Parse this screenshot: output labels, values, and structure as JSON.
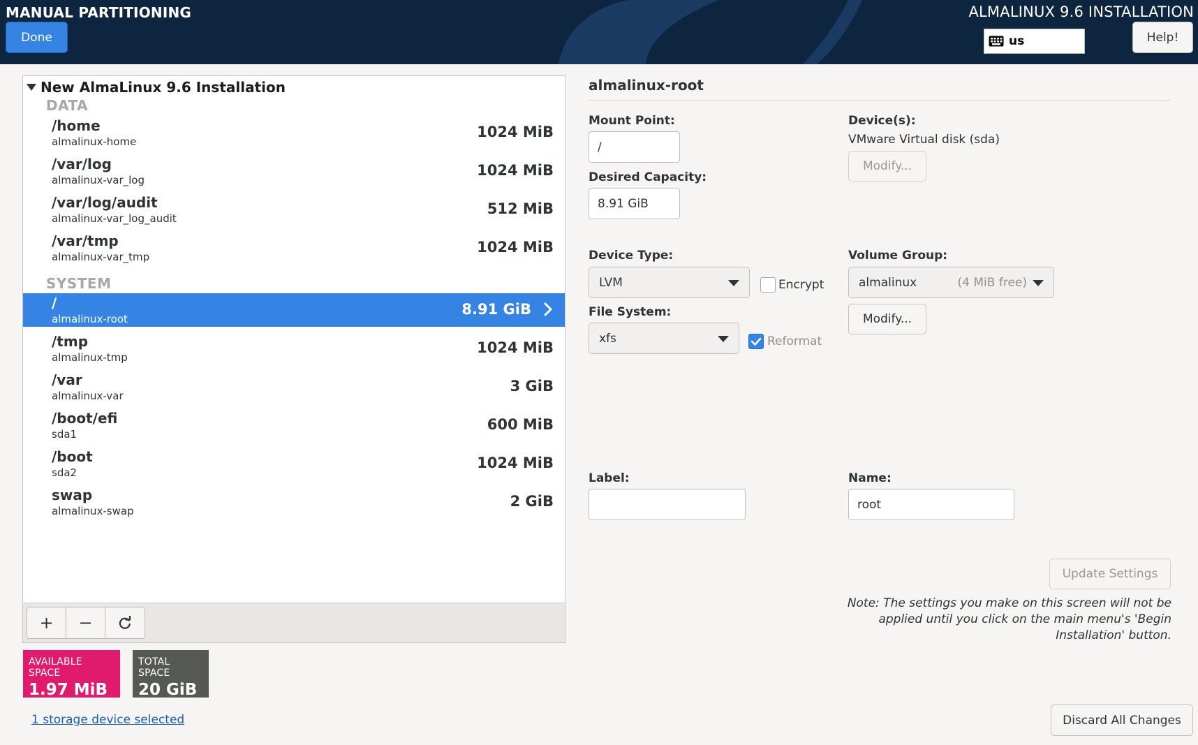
{
  "header": {
    "spoke_title": "MANUAL PARTITIONING",
    "done_label": "Done",
    "product_title": "ALMALINUX 9.6 INSTALLATION",
    "keyboard_layout": "us",
    "help_label": "Help!"
  },
  "tree": {
    "root_label": "New AlmaLinux 9.6 Installation",
    "groups": [
      {
        "name": "DATA",
        "rows": [
          {
            "mount": "/home",
            "device": "almalinux-home",
            "size": "1024 MiB"
          },
          {
            "mount": "/var/log",
            "device": "almalinux-var_log",
            "size": "1024 MiB"
          },
          {
            "mount": "/var/log/audit",
            "device": "almalinux-var_log_audit",
            "size": "512 MiB"
          },
          {
            "mount": "/var/tmp",
            "device": "almalinux-var_tmp",
            "size": "1024 MiB"
          }
        ]
      },
      {
        "name": "SYSTEM",
        "rows": [
          {
            "mount": "/",
            "device": "almalinux-root",
            "size": "8.91 GiB",
            "selected": true
          },
          {
            "mount": "/tmp",
            "device": "almalinux-tmp",
            "size": "1024 MiB"
          },
          {
            "mount": "/var",
            "device": "almalinux-var",
            "size": "3 GiB"
          },
          {
            "mount": "/boot/efi",
            "device": "sda1",
            "size": "600 MiB"
          },
          {
            "mount": "/boot",
            "device": "sda2",
            "size": "1024 MiB"
          },
          {
            "mount": "swap",
            "device": "almalinux-swap",
            "size": "2 GiB"
          }
        ]
      }
    ],
    "toolbar": {
      "add_symbol": "+",
      "remove_symbol": "−",
      "refresh_icon": "refresh-icon"
    }
  },
  "space": {
    "available_label": "AVAILABLE SPACE",
    "available_value": "1.97 MiB",
    "total_label": "TOTAL SPACE",
    "total_value": "20 GiB"
  },
  "storage_link": "1 storage device selected",
  "detail": {
    "title": "almalinux-root",
    "mount_point_label": "Mount Point:",
    "mount_point_value": "/",
    "desired_capacity_label": "Desired Capacity:",
    "desired_capacity_value": "8.91 GiB",
    "devices_label": "Device(s):",
    "devices_value": "VMware Virtual disk (sda)",
    "devices_modify_label": "Modify...",
    "device_type_label": "Device Type:",
    "device_type_value": "LVM",
    "encrypt_label": "Encrypt",
    "encrypt_checked": false,
    "volume_group_label": "Volume Group:",
    "volume_group_value": "almalinux",
    "volume_group_free": "(4 MiB free)",
    "volume_group_modify_label": "Modify...",
    "file_system_label": "File System:",
    "file_system_value": "xfs",
    "reformat_label": "Reformat",
    "reformat_checked": true,
    "label_label": "Label:",
    "label_value": "",
    "name_label": "Name:",
    "name_value": "root",
    "update_settings_label": "Update Settings",
    "note": "Note:  The settings you make on this screen will not be applied until you click on the main menu's 'Begin Installation' button.",
    "discard_label": "Discard All Changes"
  },
  "colors": {
    "header_bg": "#0e2540",
    "accent": "#3584e4",
    "available_badge": "#e01b6d",
    "total_badge": "#565856"
  }
}
